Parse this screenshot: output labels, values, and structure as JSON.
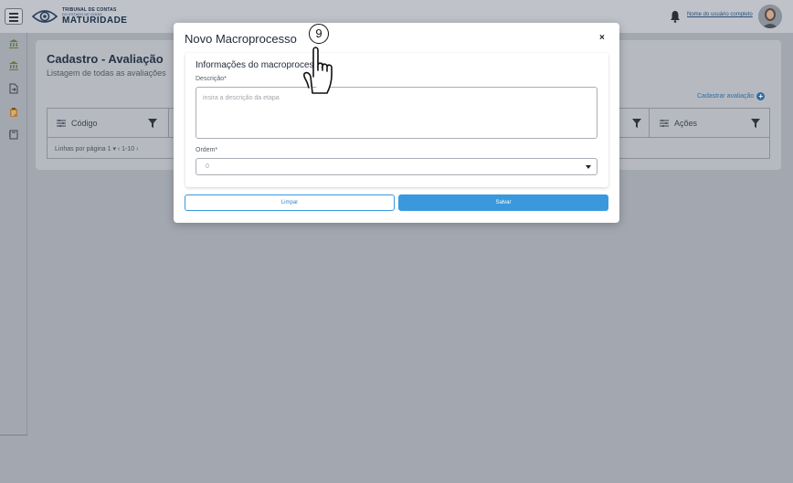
{
  "header": {
    "logo_line1": "TRIBUNAL DE CONTAS",
    "logo_line2": "DO ESTADO DE GOIÁS",
    "logo_line3": "MATURIDADE",
    "user_name": "Nome do usuário completo"
  },
  "page": {
    "title": "Cadastro -  Avaliação",
    "subtitle": "Listagem de todas as avaliações",
    "add_link": "Cadastrar avaliação",
    "columns": [
      "Código",
      "Ações"
    ],
    "pager": "Linhas por página  1 ▾  ‹  1-10  ›"
  },
  "modal": {
    "title": "Novo Macroprocesso",
    "close": "×",
    "section_title": "Informações do  macroprocesso",
    "descricao_label": "Descrição*",
    "descricao_placeholder": "insira a descrição da etapa",
    "ordem_label": "Ordem*",
    "ordem_value": "0",
    "btn_limpar": "Limpar",
    "btn_salvar": "Salvar"
  },
  "annotation": {
    "step_number": "9"
  },
  "colors": {
    "primary": "#3a98dd",
    "overlay": "#a3a8b0"
  }
}
